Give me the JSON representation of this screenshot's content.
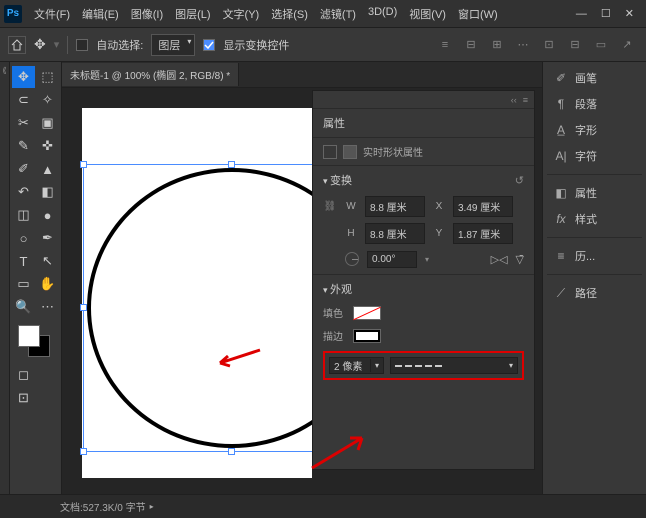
{
  "title_menu": {
    "file": "文件(F)",
    "edit": "编辑(E)",
    "image": "图像(I)",
    "layer": "图层(L)",
    "type": "文字(Y)",
    "select": "选择(S)",
    "filter": "滤镜(T)",
    "threeD": "3D(D)",
    "view": "视图(V)",
    "window": "窗口(W)"
  },
  "window_controls": {
    "min": "—",
    "max": "☐",
    "close": "✕"
  },
  "options": {
    "auto_select": "自动选择:",
    "layer_sel": "图层",
    "show_transform": "显示变换控件"
  },
  "document": {
    "tab_title": "未标题-1 @ 100% (椭圆 2, RGB/8) *"
  },
  "sidebar": {
    "brush": "画笔",
    "paragraph": "段落",
    "glyph": "字形",
    "character": "字符",
    "properties": "属性",
    "styles": "样式",
    "history": "历...",
    "paths": "路径"
  },
  "properties_panel": {
    "title": "属性",
    "subtitle": "实时形状属性",
    "transform": {
      "title": "变换",
      "w_label": "W",
      "w_value": "8.8 厘米",
      "h_label": "H",
      "h_value": "8.8 厘米",
      "x_label": "X",
      "x_value": "3.49 厘米",
      "y_label": "Y",
      "y_value": "1.87 厘米",
      "angle": "0.00°"
    },
    "appearance": {
      "title": "外观",
      "fill_label": "填色",
      "stroke_label": "描边",
      "stroke_width": "2 像素"
    }
  },
  "status": {
    "doc_info": "文档:527.3K/0 字节"
  }
}
